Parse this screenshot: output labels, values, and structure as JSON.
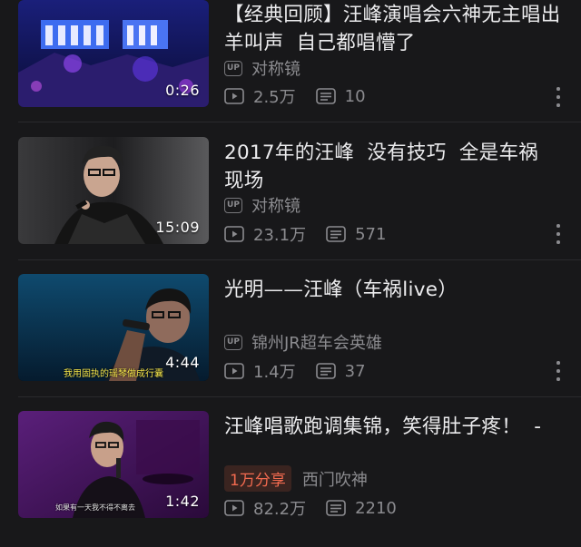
{
  "videos": [
    {
      "title": "【经典回顾】汪峰演唱会六神无主唱出\n羊叫声  自己都唱懵了",
      "author": "对称镜",
      "duration": "0:26",
      "views": "2.5万",
      "comments": "10",
      "tag": "",
      "subtitle": ""
    },
    {
      "title": "2017年的汪峰  没有技巧  全是车祸\n现场",
      "author": "对称镜",
      "duration": "15:09",
      "views": "23.1万",
      "comments": "571",
      "tag": "",
      "subtitle": ""
    },
    {
      "title": "光明——汪峰（车祸live）",
      "author": "锦州JR超车会英雄",
      "duration": "4:44",
      "views": "1.4万",
      "comments": "37",
      "tag": "",
      "subtitle": "我用固执的瑶琴做成行囊"
    },
    {
      "title": "汪峰唱歌跑调集锦，笑得肚子疼！  -",
      "author": "西门吹神",
      "duration": "1:42",
      "views": "82.2万",
      "comments": "2210",
      "tag": "1万分享",
      "subtitle": "如果有一天我不得不离去"
    }
  ],
  "badge_label": "UP",
  "icons": {
    "views": "play-count-icon",
    "comments": "danmaku-icon",
    "more": "more-vertical-icon",
    "badge": "up-badge-icon"
  },
  "colors": {
    "background": "#18181a",
    "title": "#ececee",
    "meta": "#8b8b8f",
    "tag_text": "#f26a4f",
    "tag_bg": "#3a2420"
  }
}
